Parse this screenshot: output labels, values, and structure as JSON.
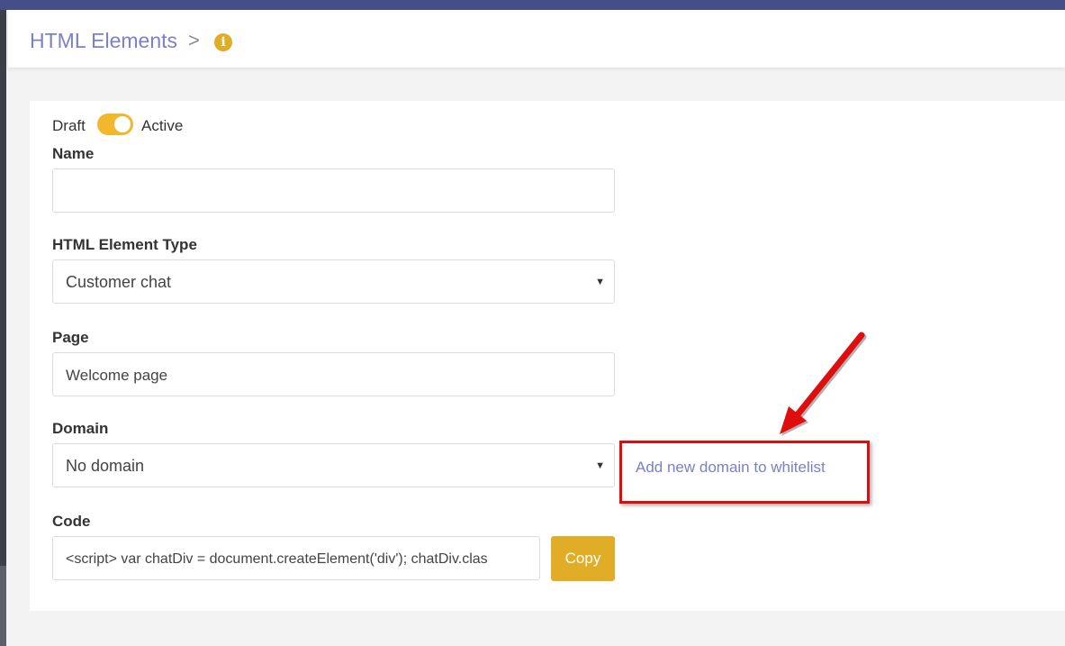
{
  "header": {
    "title": "HTML Elements",
    "separator": ">",
    "info_glyph": "i"
  },
  "status": {
    "draft_label": "Draft",
    "active_label": "Active",
    "is_active": true
  },
  "form": {
    "name": {
      "label": "Name",
      "value": ""
    },
    "element_type": {
      "label": "HTML Element Type",
      "value": "Customer chat"
    },
    "page": {
      "label": "Page",
      "value": "Welcome page"
    },
    "domain": {
      "label": "Domain",
      "value": "No domain",
      "add_link": "Add new domain to whitelist"
    },
    "code": {
      "label": "Code",
      "value": "<script> var chatDiv = document.createElement('div'); chatDiv.clas",
      "copy_label": "Copy"
    }
  },
  "colors": {
    "accent": "#7a80c9",
    "toggle": "#f1b82d",
    "button": "#e2ad26",
    "highlight": "#dc0d0d",
    "topbar": "#454e86"
  },
  "icons": {
    "caret": "▼"
  }
}
